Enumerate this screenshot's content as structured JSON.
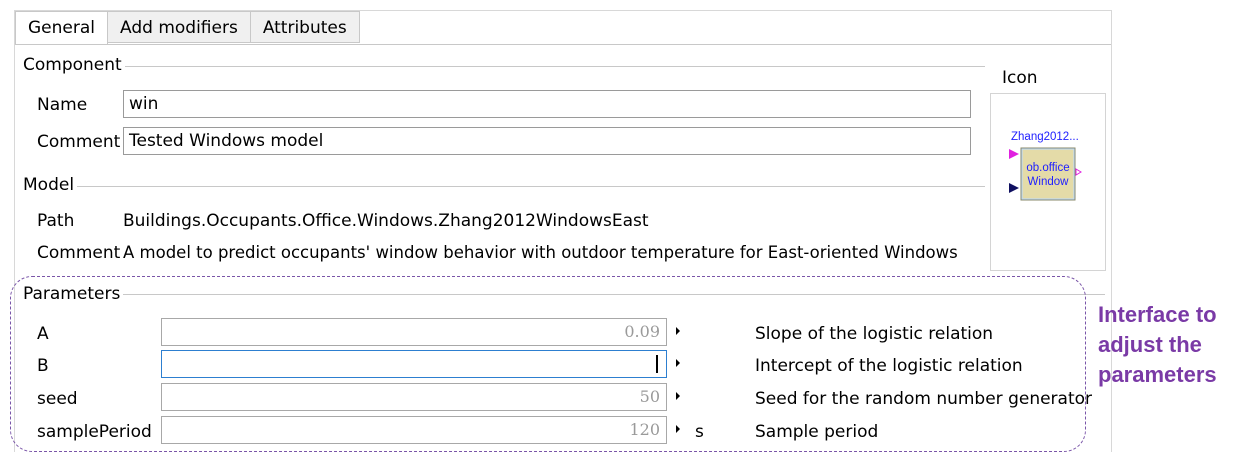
{
  "tabs": [
    {
      "label": "General",
      "active": true
    },
    {
      "label": "Add modifiers",
      "active": false
    },
    {
      "label": "Attributes",
      "active": false
    }
  ],
  "component": {
    "title": "Component",
    "name_label": "Name",
    "name_value": "win",
    "comment_label": "Comment",
    "comment_value": "Tested Windows model"
  },
  "icon": {
    "title": "Icon",
    "class_label": "Zhang2012...",
    "inner_text_1": "ob.office",
    "inner_text_2": "Window",
    "colors": {
      "block_fill": "#e4dba8",
      "input_top": "#e020e0",
      "input_bottom": "#101060",
      "label": "#2020ff"
    }
  },
  "model": {
    "title": "Model",
    "path_label": "Path",
    "path_value": "Buildings.Occupants.Office.Windows.Zhang2012WindowsEast",
    "comment_label": "Comment",
    "comment_value": "A model to predict occupants' window behavior with outdoor temperature for East-oriented Windows"
  },
  "parameters": {
    "title": "Parameters",
    "rows": [
      {
        "name": "A",
        "value": "0.09",
        "unit": "",
        "description": "Slope of the logistic relation"
      },
      {
        "name": "B",
        "value": "",
        "unit": "",
        "description": "Intercept of the logistic relation"
      },
      {
        "name": "seed",
        "value": "50",
        "unit": "",
        "description": "Seed for the random number generator"
      },
      {
        "name": "samplePeriod",
        "value": "120",
        "unit": "s",
        "description": "Sample period"
      }
    ]
  },
  "annotation": {
    "text": "Interface to adjust the parameters",
    "color": "#7a3aa6"
  }
}
